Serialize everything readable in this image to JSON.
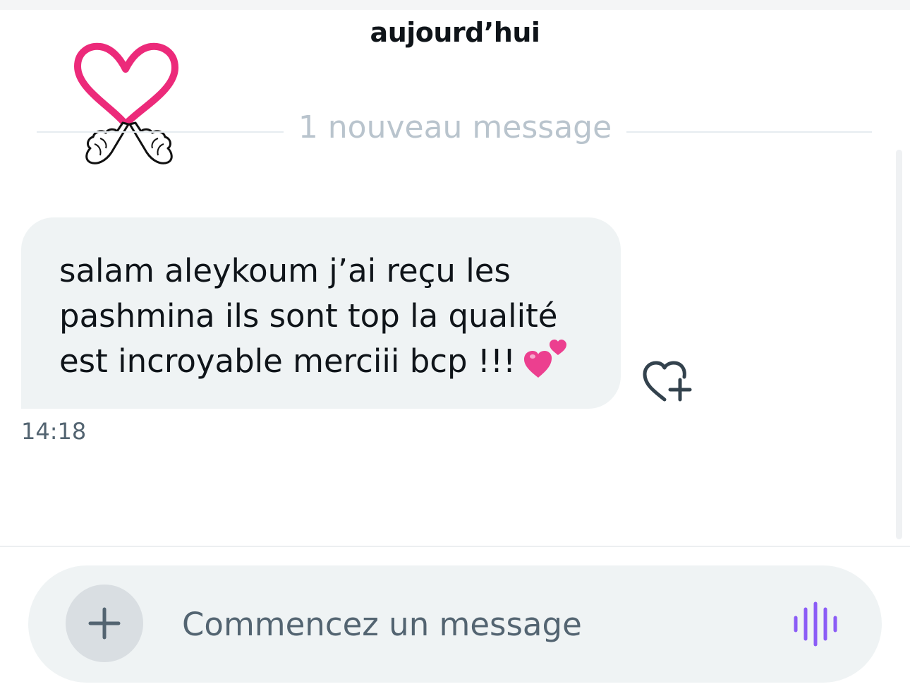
{
  "header": {
    "date_label": "aujourd’hui"
  },
  "conversation": {
    "new_message_divider": "1 nouveau message",
    "messages": [
      {
        "lines": [
          "salam aleykoum j’ai reçu les",
          "pashmina ils sont top la qualité",
          "est incroyable merciii bcp !!!"
        ],
        "emoji": "two-hearts-emoji",
        "timestamp": "14:18"
      }
    ]
  },
  "sticker": {
    "icon": "heart-hands-sticker",
    "heart_color": "#ec2a7a"
  },
  "composer": {
    "placeholder": "Commencez un message",
    "add_icon": "plus-icon",
    "voice_icon": "voice-waveform-icon",
    "voice_color": "#8b5cf6"
  },
  "colors": {
    "bubble": "#eff3f4",
    "text": "#0f1419",
    "muted": "#536471"
  }
}
